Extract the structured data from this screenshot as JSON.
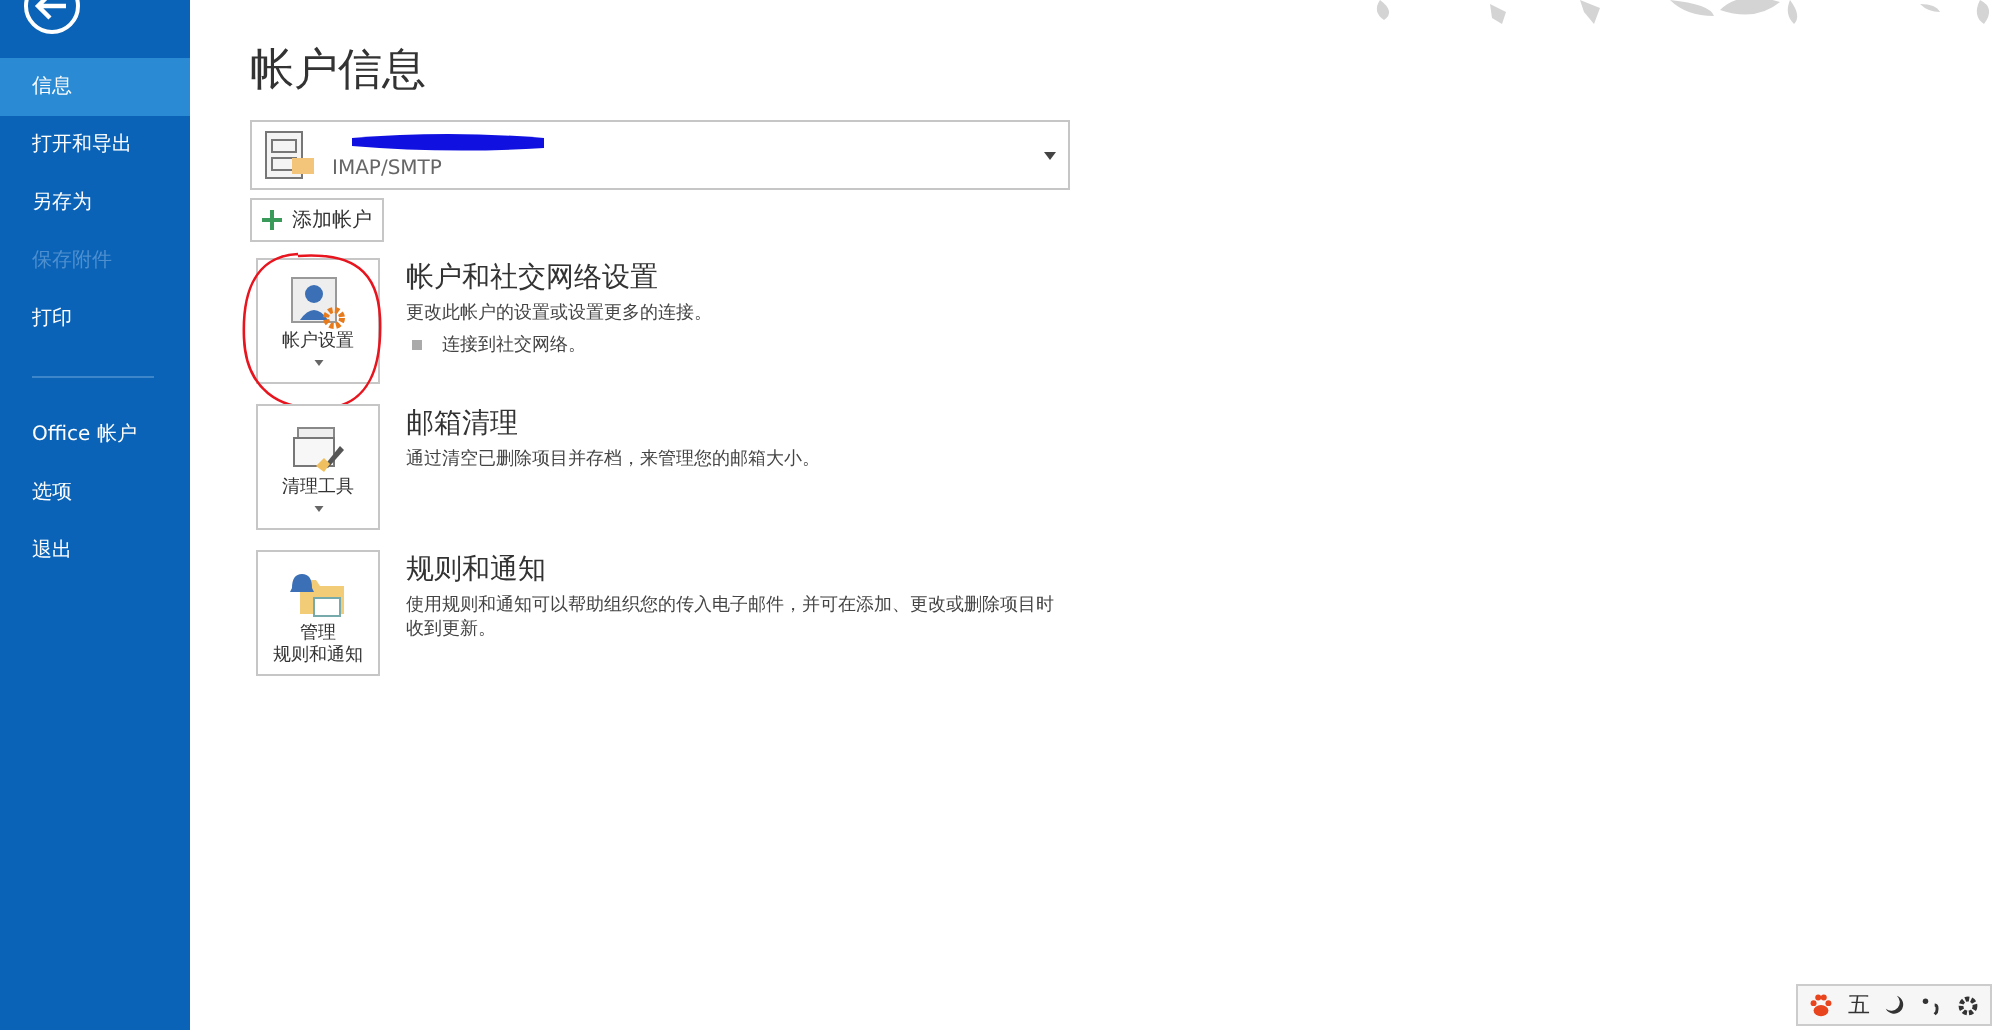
{
  "sidebar": {
    "items": [
      {
        "label": "信息",
        "selected": true,
        "disabled": false,
        "divider_after": false
      },
      {
        "label": "打开和导出",
        "selected": false,
        "disabled": false,
        "divider_after": false
      },
      {
        "label": "另存为",
        "selected": false,
        "disabled": false,
        "divider_after": false
      },
      {
        "label": "保存附件",
        "selected": false,
        "disabled": true,
        "divider_after": false
      },
      {
        "label": "打印",
        "selected": false,
        "disabled": false,
        "divider_after": true
      },
      {
        "label": "Office 帐户",
        "selected": false,
        "disabled": false,
        "divider_after": false
      },
      {
        "label": "选项",
        "selected": false,
        "disabled": false,
        "divider_after": false
      },
      {
        "label": "退出",
        "selected": false,
        "disabled": false,
        "divider_after": false
      }
    ]
  },
  "page_title": "帐户信息",
  "account": {
    "type": "IMAP/SMTP",
    "address_redacted": true
  },
  "add_account_button": "添加帐户",
  "actions": [
    {
      "kind": "account",
      "button_lines": [
        "帐户设置"
      ],
      "has_dropdown": true,
      "circled": true,
      "title": "帐户和社交网络设置",
      "description": "更改此帐户的设置或设置更多的连接。",
      "bullets": [
        "连接到社交网络。"
      ]
    },
    {
      "kind": "cleanup",
      "button_lines": [
        "清理工具"
      ],
      "has_dropdown": true,
      "circled": false,
      "title": "邮箱清理",
      "description": "通过清空已删除项目并存档，来管理您的邮箱大小。"
    },
    {
      "kind": "rules",
      "button_lines": [
        "管理",
        "规则和通知"
      ],
      "has_dropdown": false,
      "circled": false,
      "title": "规则和通知",
      "description": "使用规则和通知可以帮助组织您的传入电子邮件，并可在添加、更改或删除项目时收到更新。"
    }
  ],
  "ime_bar": {
    "mode_label": "五"
  }
}
